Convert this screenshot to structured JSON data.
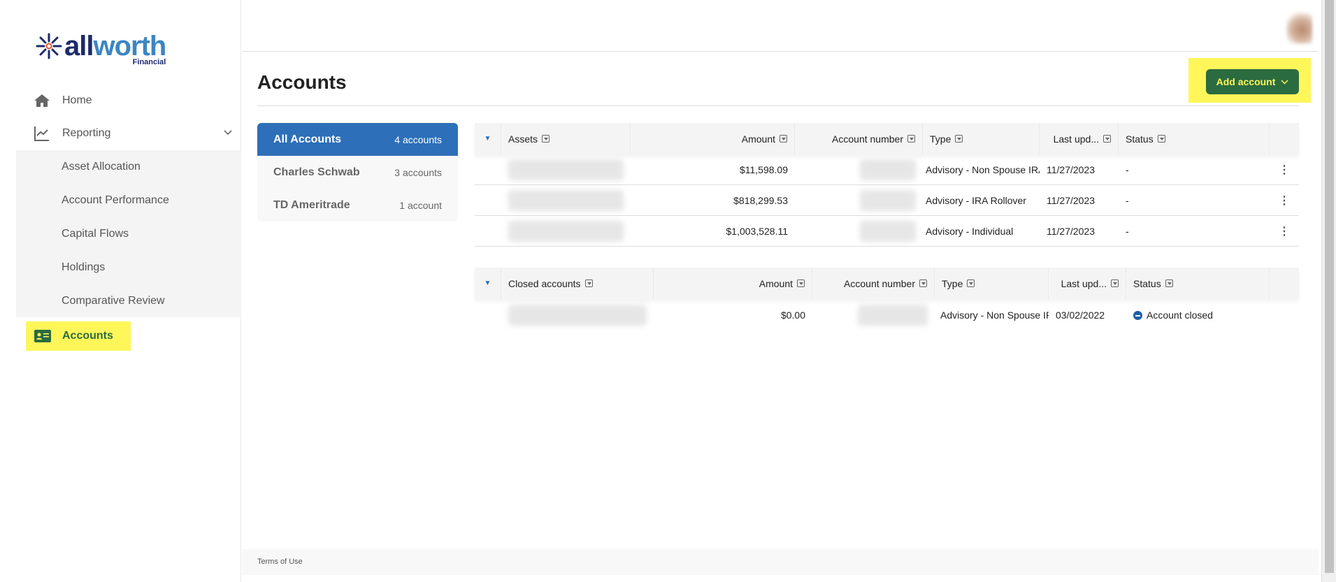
{
  "brand": {
    "name_part1": "all",
    "name_part2": "worth",
    "sub": "Financial"
  },
  "sidebar": {
    "home": "Home",
    "reporting": "Reporting",
    "sub_items": [
      "Asset Allocation",
      "Account Performance",
      "Capital Flows",
      "Holdings",
      "Comparative Review"
    ],
    "accounts": "Accounts"
  },
  "page": {
    "title": "Accounts",
    "add_button": "Add account"
  },
  "institutions": [
    {
      "name": "All Accounts",
      "count": "4 accounts",
      "active": true
    },
    {
      "name": "Charles Schwab",
      "count": "3 accounts"
    },
    {
      "name": "TD Ameritrade",
      "count": "1 account"
    }
  ],
  "assets_table": {
    "headers": [
      "Assets",
      "Amount",
      "Account number",
      "Type",
      "Last upd...",
      "Status"
    ],
    "rows": [
      {
        "amount": "$11,598.09",
        "type": "Advisory - Non Spouse IRA",
        "date": "11/27/2023",
        "status": "-"
      },
      {
        "amount": "$818,299.53",
        "type": "Advisory - IRA Rollover",
        "date": "11/27/2023",
        "status": "-"
      },
      {
        "amount": "$1,003,528.11",
        "type": "Advisory - Individual",
        "date": "11/27/2023",
        "status": "-"
      }
    ]
  },
  "closed_table": {
    "headers": [
      "Closed accounts",
      "Amount",
      "Account number",
      "Type",
      "Last upd...",
      "Status"
    ],
    "rows": [
      {
        "amount": "$0.00",
        "type": "Advisory - Non Spouse IRA",
        "date": "03/02/2022",
        "status": "Account closed"
      }
    ]
  },
  "footer": {
    "terms": "Terms of Use"
  },
  "colors": {
    "primary": "#2d6fb8",
    "button": "#2b6b40",
    "highlight": "#fff65a"
  }
}
